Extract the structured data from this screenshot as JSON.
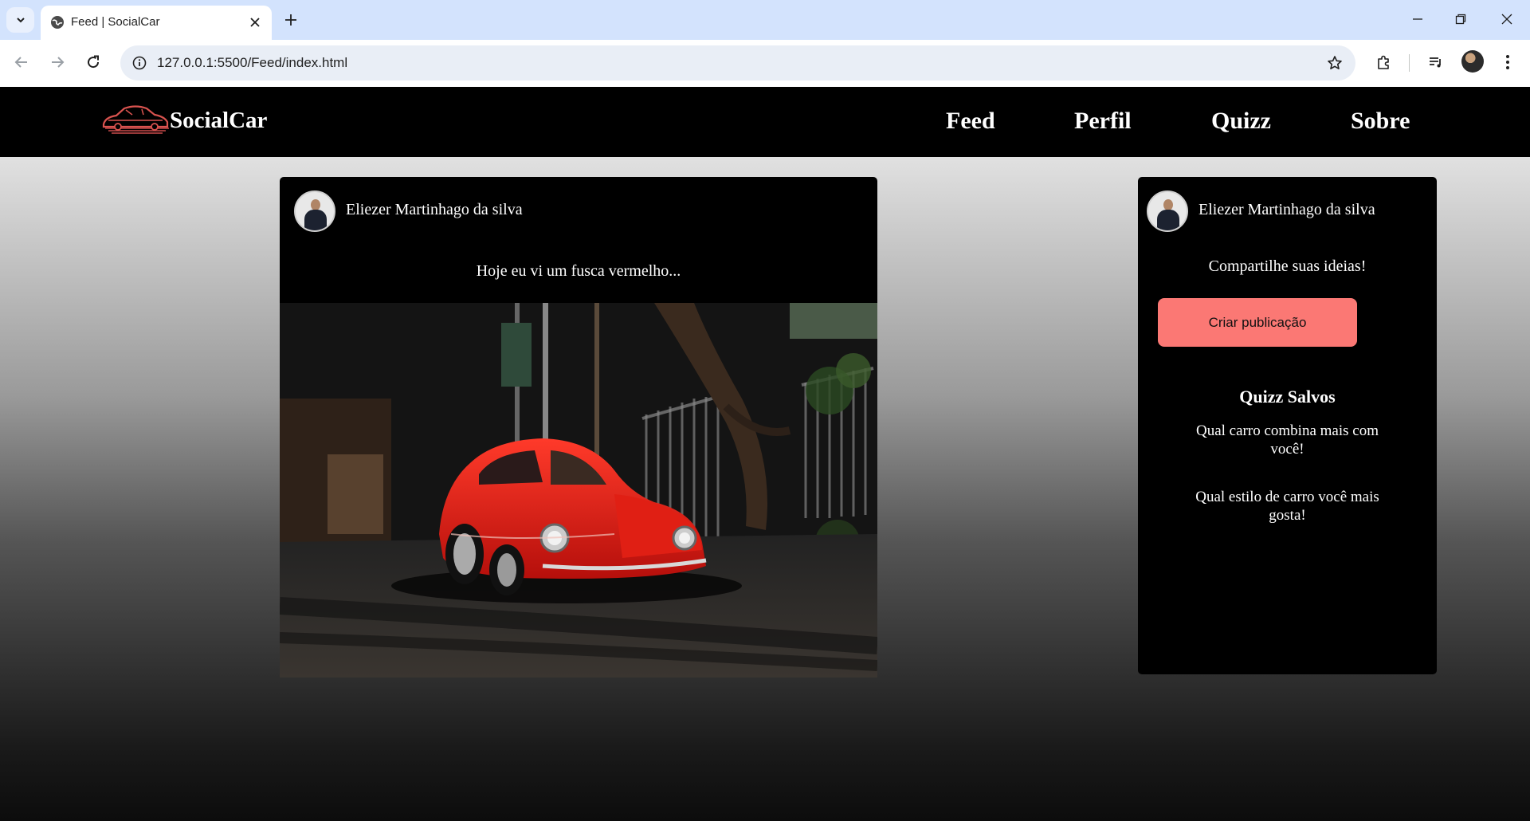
{
  "browser": {
    "tab_title": "Feed | SocialCar",
    "url": "127.0.0.1:5500/Feed/index.html"
  },
  "header": {
    "brand": "SocialCar",
    "nav": [
      "Feed",
      "Perfil",
      "Quizz",
      "Sobre"
    ]
  },
  "post": {
    "author": "Eliezer Martinhago da silva",
    "text": "Hoje eu vi um fusca vermelho...",
    "image_icon": "red-beetle-photo"
  },
  "sidebar": {
    "author": "Eliezer Martinhago da silva",
    "share_prompt": "Compartilhe suas ideias!",
    "create_button": "Criar publicação",
    "quizz_title": "Quizz Salvos",
    "quizz_items": [
      "Qual carro combina mais com você!",
      "Qual estilo de carro você mais gosta!"
    ]
  },
  "colors": {
    "accent": "#fb7874",
    "header_bg": "#000000",
    "chrome_tabbar": "#d3e3fd"
  }
}
